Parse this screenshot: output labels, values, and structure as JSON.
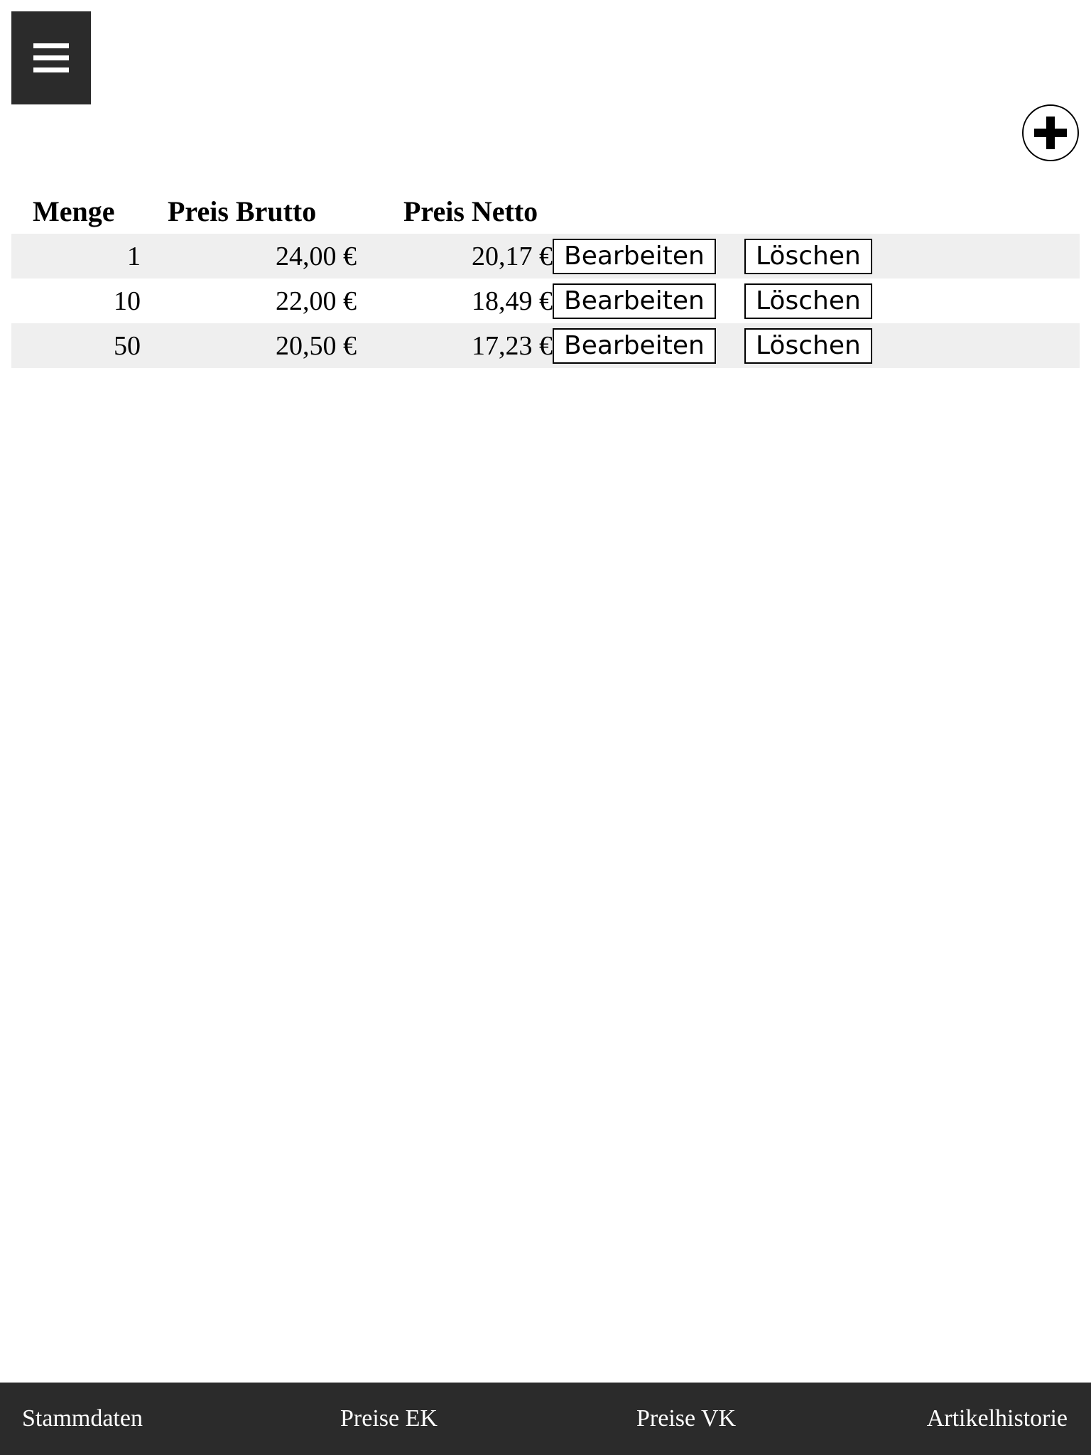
{
  "header": {
    "menu_icon": "hamburger-menu-icon",
    "add_icon": "plus-circle-icon"
  },
  "table": {
    "columns": [
      "Menge",
      "Preis Brutto",
      "Preis Netto"
    ],
    "rows": [
      {
        "qty": "1",
        "gross": "24,00 €",
        "net": "20,17 €",
        "edit": "Bearbeiten",
        "delete": "Löschen"
      },
      {
        "qty": "10",
        "gross": "22,00 €",
        "net": "18,49 €",
        "edit": "Bearbeiten",
        "delete": "Löschen"
      },
      {
        "qty": "50",
        "gross": "20,50 €",
        "net": "17,23 €",
        "edit": "Bearbeiten",
        "delete": "Löschen"
      }
    ],
    "row_stripe_color": "#efefef"
  },
  "footer": {
    "background": "#2b2b2b",
    "items": [
      "Stammdaten",
      "Preise EK",
      "Preise VK",
      "Artikelhistorie"
    ]
  }
}
